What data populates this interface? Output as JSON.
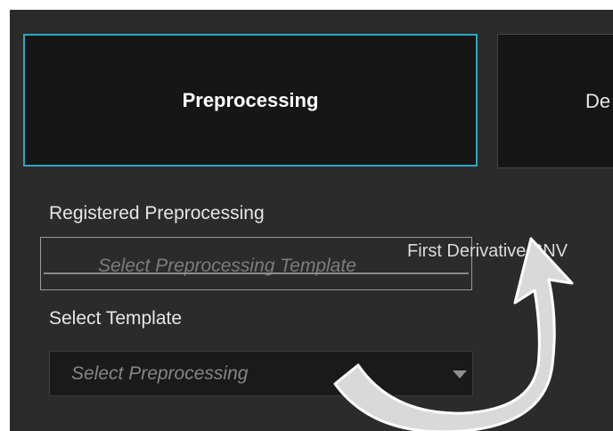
{
  "tabs": {
    "preprocessing_label": "Preprocessing",
    "derivative_label": "De"
  },
  "registered": {
    "label": "Registered Preprocessing",
    "placeholder": "Select Preprocessing Template",
    "dragged_item": "First Derivative SNV"
  },
  "template": {
    "label": "Select Template",
    "placeholder": "Select Preprocessing"
  },
  "colors": {
    "panel_background": "#2b2b2b",
    "tab_background": "#161616",
    "active_tab_border": "#2aa7c4",
    "arrow_fill": "#d9d9d9",
    "arrow_stroke": "#ffffff"
  },
  "icons": {
    "dropdown": "chevron-down-icon",
    "annotation": "curved-arrow-icon"
  }
}
